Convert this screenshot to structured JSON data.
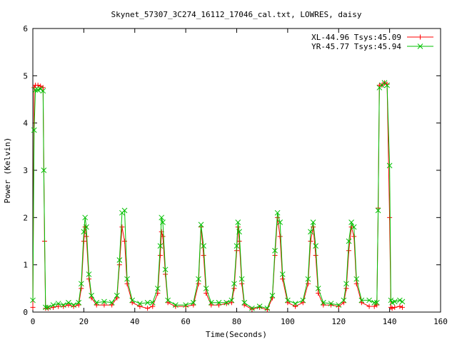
{
  "chart_data": {
    "type": "line",
    "title": "Skynet_57307_3C274_16112_17046_cal.txt, LOWRES, daisy",
    "xlabel": "Time(Seconds)",
    "ylabel": "Power (Kelvin)",
    "xlim": [
      0,
      160
    ],
    "ylim": [
      0,
      6
    ],
    "x_ticks": [
      "0",
      "20",
      "40",
      "60",
      "80",
      "100",
      "120",
      "140",
      "160"
    ],
    "y_ticks": [
      "0",
      "1",
      "2",
      "3",
      "4",
      "5",
      "6"
    ],
    "legend_position": "top-right",
    "grid": false,
    "series": [
      {
        "name": "XL-44.96 Tsys:45.09",
        "color": "#ff0000",
        "marker": "plus",
        "x": [
          0,
          0.5,
          1,
          2,
          3,
          4,
          4.6,
          5,
          6,
          8,
          10,
          12,
          14,
          16,
          18,
          19,
          20,
          20.5,
          21,
          22,
          23,
          25,
          28,
          31,
          33,
          34,
          35,
          36,
          37,
          39,
          42,
          45,
          47,
          49,
          50,
          50.5,
          51,
          52,
          53,
          56,
          60,
          63,
          65,
          66,
          67,
          68,
          70,
          73,
          76,
          78,
          79,
          80,
          80.5,
          81,
          82,
          83,
          86,
          89,
          92,
          94,
          95,
          96,
          97,
          98,
          100,
          103,
          106,
          108,
          109,
          110,
          111,
          112,
          114,
          117,
          120,
          122,
          123,
          124,
          125,
          126,
          127,
          129,
          132,
          134,
          135,
          135.5,
          136,
          137,
          138,
          139,
          140,
          140.5,
          141,
          142,
          144,
          145
        ],
        "y": [
          0.1,
          4.75,
          4.8,
          4.8,
          4.78,
          4.75,
          1.5,
          0.08,
          0.08,
          0.1,
          0.12,
          0.12,
          0.15,
          0.12,
          0.15,
          0.5,
          1.5,
          1.8,
          1.6,
          0.7,
          0.3,
          0.15,
          0.15,
          0.15,
          0.3,
          1.0,
          1.8,
          1.5,
          0.6,
          0.2,
          0.12,
          0.08,
          0.12,
          0.4,
          1.2,
          1.7,
          1.6,
          0.8,
          0.2,
          0.12,
          0.12,
          0.15,
          0.6,
          1.8,
          1.2,
          0.4,
          0.15,
          0.15,
          0.18,
          0.2,
          0.5,
          1.3,
          1.8,
          1.5,
          0.6,
          0.15,
          0.06,
          0.1,
          0.05,
          0.3,
          1.2,
          2.0,
          1.6,
          0.7,
          0.2,
          0.12,
          0.2,
          0.6,
          1.5,
          1.8,
          1.2,
          0.4,
          0.15,
          0.15,
          0.12,
          0.2,
          0.5,
          1.3,
          1.8,
          1.6,
          0.6,
          0.2,
          0.12,
          0.12,
          0.15,
          2.2,
          4.8,
          4.8,
          4.85,
          4.82,
          2.0,
          0.1,
          0.08,
          0.1,
          0.12,
          0.1
        ]
      },
      {
        "name": "YR-45.77 Tsys:45.94",
        "color": "#00c000",
        "marker": "cross",
        "x": [
          0,
          0.5,
          1,
          2,
          3,
          4,
          4.3,
          5,
          6,
          8,
          10,
          12,
          14,
          16,
          18,
          19,
          20,
          20.5,
          21,
          22,
          23,
          25,
          28,
          31,
          33,
          34,
          35,
          36,
          37,
          39,
          42,
          45,
          47,
          49,
          50,
          50.5,
          51,
          52,
          53,
          56,
          60,
          63,
          65,
          66,
          67,
          68,
          70,
          73,
          76,
          78,
          79,
          80,
          80.5,
          81,
          82,
          83,
          86,
          89,
          92,
          94,
          95,
          96,
          97,
          98,
          100,
          103,
          106,
          108,
          109,
          110,
          111,
          112,
          114,
          117,
          120,
          122,
          123,
          124,
          125,
          126,
          127,
          129,
          132,
          134,
          135,
          135.5,
          136,
          137,
          138,
          139,
          140,
          140.5,
          141,
          142,
          144,
          145
        ],
        "y": [
          0.25,
          3.85,
          4.7,
          4.7,
          4.72,
          4.68,
          3.0,
          0.1,
          0.1,
          0.15,
          0.18,
          0.15,
          0.2,
          0.15,
          0.2,
          0.6,
          1.7,
          2.0,
          1.8,
          0.8,
          0.35,
          0.2,
          0.22,
          0.2,
          0.35,
          1.1,
          2.1,
          2.15,
          0.7,
          0.25,
          0.18,
          0.2,
          0.2,
          0.5,
          1.4,
          2.0,
          1.9,
          0.9,
          0.25,
          0.15,
          0.15,
          0.2,
          0.7,
          1.85,
          1.4,
          0.5,
          0.2,
          0.2,
          0.2,
          0.25,
          0.6,
          1.4,
          1.9,
          1.7,
          0.7,
          0.2,
          0.08,
          0.12,
          0.08,
          0.35,
          1.3,
          2.1,
          1.9,
          0.8,
          0.25,
          0.18,
          0.25,
          0.7,
          1.7,
          1.9,
          1.4,
          0.5,
          0.2,
          0.18,
          0.15,
          0.25,
          0.6,
          1.5,
          1.9,
          1.8,
          0.7,
          0.25,
          0.25,
          0.2,
          0.2,
          2.15,
          4.75,
          4.8,
          4.85,
          4.8,
          3.1,
          0.25,
          0.2,
          0.22,
          0.25,
          0.22
        ]
      }
    ]
  }
}
